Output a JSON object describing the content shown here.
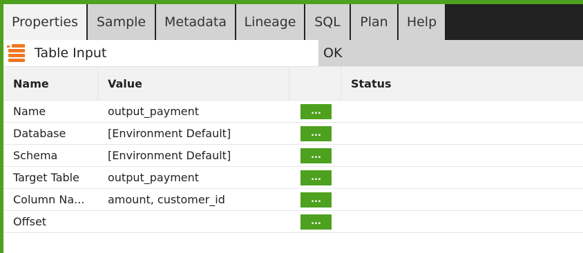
{
  "colors": {
    "accent": "#4ea11f",
    "component_icon": "#f07820",
    "tab_bg": "#d3d3d3",
    "tab_active_bg": "#f2f2f2",
    "tabstrip_bg": "#222222"
  },
  "tabs": [
    {
      "label": "Properties",
      "active": true
    },
    {
      "label": "Sample",
      "active": false
    },
    {
      "label": "Metadata",
      "active": false
    },
    {
      "label": "Lineage",
      "active": false
    },
    {
      "label": "SQL",
      "active": false
    },
    {
      "label": "Plan",
      "active": false
    },
    {
      "label": "Help",
      "active": false
    }
  ],
  "component": {
    "icon": "table-input-icon",
    "name": "Table Input",
    "status": "OK"
  },
  "table": {
    "headers": {
      "name": "Name",
      "value": "Value",
      "button": "",
      "status": "Status"
    },
    "rows": [
      {
        "name": "Name",
        "value": "output_payment",
        "button": "...",
        "status": ""
      },
      {
        "name": "Database",
        "value": "[Environment Default]",
        "button": "...",
        "status": ""
      },
      {
        "name": "Schema",
        "value": "[Environment Default]",
        "button": "...",
        "status": ""
      },
      {
        "name": "Target Table",
        "value": "output_payment",
        "button": "...",
        "status": ""
      },
      {
        "name": "Column Na...",
        "value": "amount, customer_id",
        "button": "...",
        "status": ""
      },
      {
        "name": "Offset",
        "value": "",
        "button": "...",
        "status": ""
      }
    ]
  }
}
